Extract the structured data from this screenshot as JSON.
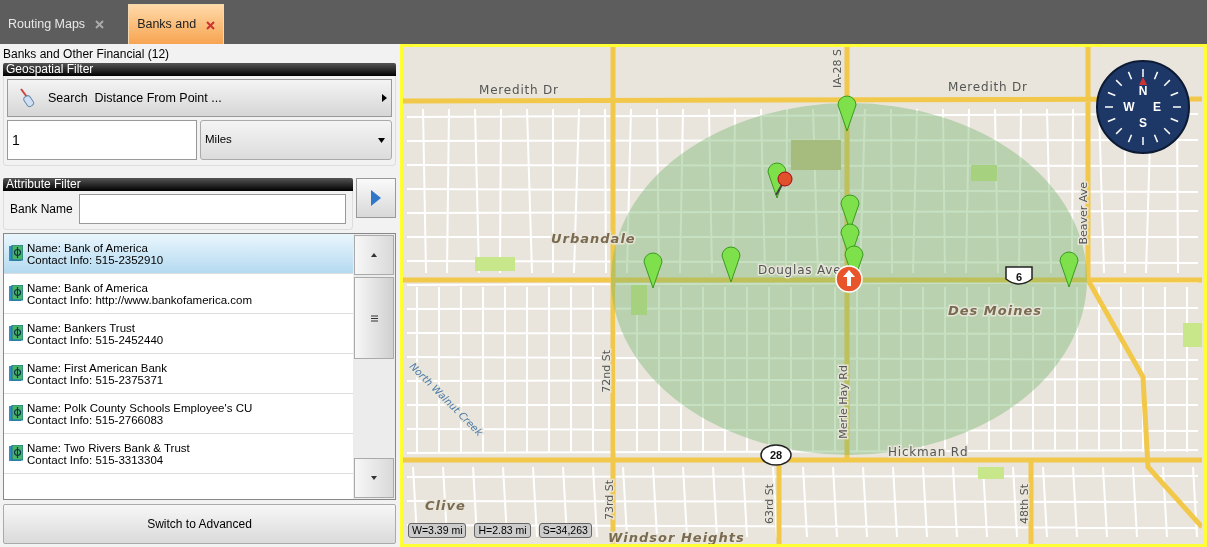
{
  "tabs": [
    {
      "label": "Routing Maps",
      "selected": false
    },
    {
      "label": "Banks and",
      "selected": true
    }
  ],
  "panel": {
    "title": "Banks and Other Financial (12)",
    "geospatial_filter": {
      "heading": "Geospatial Filter",
      "search_button": "Search  Distance From Point ...",
      "distance": "1",
      "unit": "Miles"
    },
    "attribute_filter": {
      "heading": "Attribute Filter",
      "field_label": "Bank Name"
    },
    "results": [
      {
        "name": "Name: Bank of America",
        "contact": "Contact Info: 515-2352910",
        "selected": true
      },
      {
        "name": "Name: Bank of America",
        "contact": "Contact Info: http://www.bankofamerica.com",
        "selected": false
      },
      {
        "name": "Name: Bankers Trust",
        "contact": "Contact Info: 515-2452440",
        "selected": false
      },
      {
        "name": "Name: First American Bank",
        "contact": "Contact Info: 515-2375371",
        "selected": false
      },
      {
        "name": "Name: Polk County Schools Employee's CU",
        "contact": "Contact Info: 515-2766083",
        "selected": false
      },
      {
        "name": "Name: Two Rivers Bank & Trust",
        "contact": "Contact Info: 515-3313304",
        "selected": false
      }
    ],
    "switch_button": "Switch to Advanced"
  },
  "map": {
    "labels": [
      {
        "text": "Meredith Dr",
        "kind": "street"
      },
      {
        "text": "Meredith Dr",
        "kind": "street"
      },
      {
        "text": "IA-28 S",
        "kind": "street-vertical"
      },
      {
        "text": "Beaver Ave",
        "kind": "street-vertical"
      },
      {
        "text": "Urbandale",
        "kind": "place"
      },
      {
        "text": "Douglas Ave",
        "kind": "street"
      },
      {
        "text": "Des Moines",
        "kind": "place"
      },
      {
        "text": "72nd St",
        "kind": "street-vertical"
      },
      {
        "text": "North Walnut Creek",
        "kind": "water"
      },
      {
        "text": "Merle Hay Rd",
        "kind": "street-vertical"
      },
      {
        "text": "Hickman Rd",
        "kind": "street"
      },
      {
        "text": "Clive",
        "kind": "place"
      },
      {
        "text": "73rd St",
        "kind": "street-vertical"
      },
      {
        "text": "63rd St",
        "kind": "street-vertical"
      },
      {
        "text": "48th St",
        "kind": "street-vertical"
      },
      {
        "text": "Windsor Heights",
        "kind": "place"
      }
    ],
    "shields": [
      {
        "text": "28",
        "kind": "state"
      },
      {
        "text": "6",
        "kind": "us"
      }
    ],
    "compass": {
      "north": "N",
      "east": "E",
      "south": "S",
      "west": "W"
    },
    "scale": [
      "W=3.39 mi",
      "H=2.83 mi",
      "S=34,263"
    ]
  }
}
